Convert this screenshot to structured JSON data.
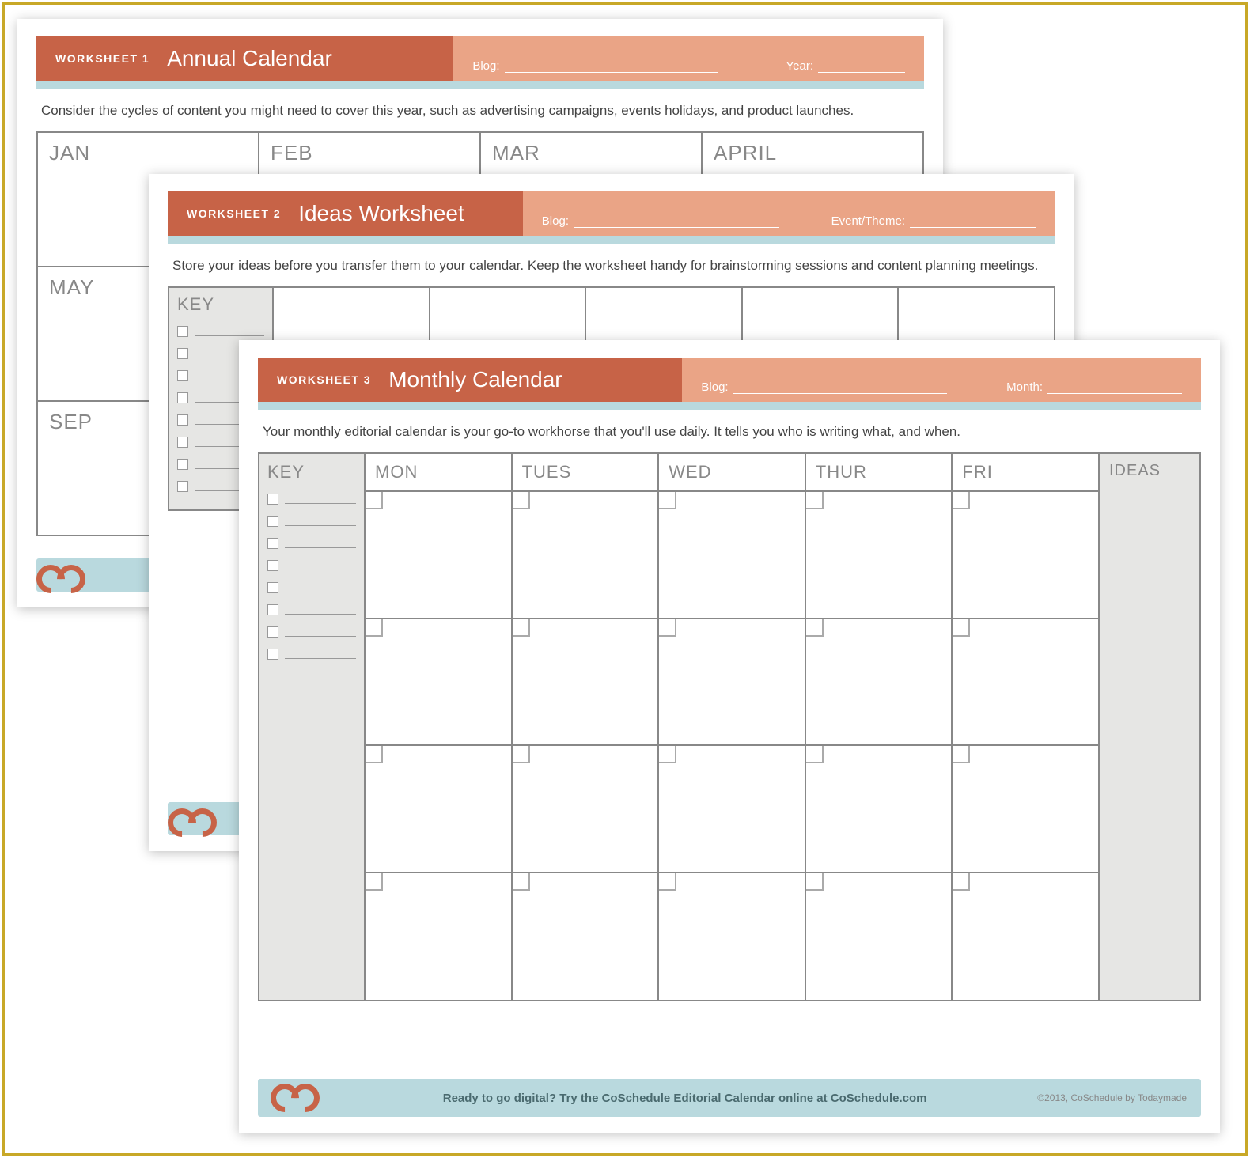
{
  "sheet1": {
    "ws_label": "WORKSHEET 1",
    "title": "Annual Calendar",
    "field1": "Blog:",
    "field2": "Year:",
    "desc": "Consider the cycles of content you might need to cover this year, such as advertising campaigns, events holidays, and product launches.",
    "months": [
      "JAN",
      "FEB",
      "MAR",
      "APRIL",
      "MAY",
      "",
      "",
      "",
      "SEP",
      "",
      "",
      ""
    ]
  },
  "sheet2": {
    "ws_label": "WORKSHEET 2",
    "title": "Ideas Worksheet",
    "field1": "Blog:",
    "field2": "Event/Theme:",
    "desc": "Store your ideas before you transfer them to your calendar. Keep the worksheet handy for brainstorming sessions and content planning meetings.",
    "key_label": "KEY",
    "key_rows": 8
  },
  "sheet3": {
    "ws_label": "WORKSHEET 3",
    "title": "Monthly Calendar",
    "field1": "Blog:",
    "field2": "Month:",
    "desc": "Your monthly editorial calendar is your go-to workhorse that you'll use daily. It tells you who is writing what, and when.",
    "key_label": "KEY",
    "key_rows": 8,
    "days": [
      "MON",
      "TUES",
      "WED",
      "THUR",
      "FRI"
    ],
    "ideas_label": "IDEAS",
    "footer": "Ready to go digital? Try the CoSchedule Editorial Calendar online at CoSchedule.com",
    "copyright": "©2013, CoSchedule by Todaymade"
  }
}
